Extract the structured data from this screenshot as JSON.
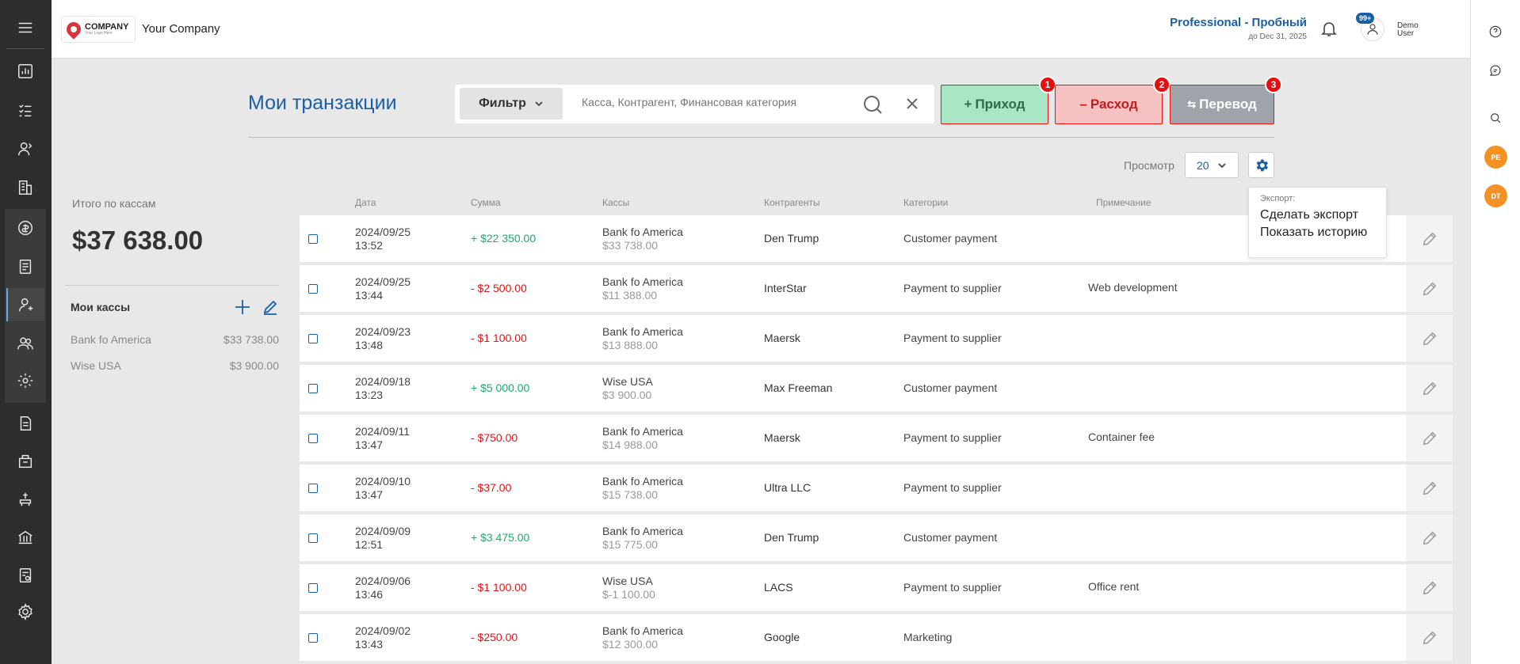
{
  "header": {
    "logo_text": "COMPANY",
    "logo_tagline": "Your Logo Here",
    "company_name": "Your Company",
    "plan_title": "Professional - Пробный",
    "plan_expiry": "до Dec 31, 2025",
    "notifications_badge": "99+",
    "user_name": "Demo User"
  },
  "page": {
    "title": "Мои транзакции",
    "filter_label": "Фильтр",
    "search_placeholder": "Касса, Контрагент, Финансовая категория"
  },
  "actions": {
    "income_label": "Приход",
    "income_badge": "1",
    "expense_label": "Расход",
    "expense_badge": "2",
    "transfer_label": "Перевод",
    "transfer_badge": "3"
  },
  "view": {
    "label": "Просмотр",
    "page_size": "20"
  },
  "export_menu": {
    "title": "Экспорт:",
    "items": [
      "Сделать экспорт",
      "Показать историю"
    ]
  },
  "summary": {
    "total_label": "Итого по кассам",
    "total_value": "$37 638.00",
    "cash_title": "Мои кассы",
    "cashboxes": [
      {
        "name": "Bank fo America",
        "amount": "$33 738.00"
      },
      {
        "name": "Wise USA",
        "amount": "$3 900.00"
      }
    ]
  },
  "table": {
    "columns": [
      "Дата",
      "Сумма",
      "Кассы",
      "Контрагенты",
      "Категории",
      "Примечание"
    ],
    "rows": [
      {
        "date": "2024/09/25",
        "time": "13:52",
        "amount": "+ $22 350.00",
        "type": "pos",
        "account": "Bank fo America",
        "balance": "$33 738.00",
        "counterparty": "Den Trump",
        "category": "Customer payment",
        "note": ""
      },
      {
        "date": "2024/09/25",
        "time": "13:44",
        "amount": "- $2 500.00",
        "type": "neg",
        "account": "Bank fo America",
        "balance": "$11 388.00",
        "counterparty": "InterStar",
        "category": "Payment to supplier",
        "note": "Web development"
      },
      {
        "date": "2024/09/23",
        "time": "13:48",
        "amount": "- $1 100.00",
        "type": "neg",
        "account": "Bank fo America",
        "balance": "$13 888.00",
        "counterparty": "Maersk",
        "category": "Payment to supplier",
        "note": ""
      },
      {
        "date": "2024/09/18",
        "time": "13:23",
        "amount": "+ $5 000.00",
        "type": "pos",
        "account": "Wise USA",
        "balance": "$3 900.00",
        "counterparty": "Max Freeman",
        "category": "Customer payment",
        "note": ""
      },
      {
        "date": "2024/09/11",
        "time": "13:47",
        "amount": "- $750.00",
        "type": "neg",
        "account": "Bank fo America",
        "balance": "$14 988.00",
        "counterparty": "Maersk",
        "category": "Payment to supplier",
        "note": "Container fee"
      },
      {
        "date": "2024/09/10",
        "time": "13:47",
        "amount": "- $37.00",
        "type": "neg",
        "account": "Bank fo America",
        "balance": "$15 738.00",
        "counterparty": "Ultra LLC",
        "category": "Payment to supplier",
        "note": ""
      },
      {
        "date": "2024/09/09",
        "time": "12:51",
        "amount": "+ $3 475.00",
        "type": "pos",
        "account": "Bank fo America",
        "balance": "$15 775.00",
        "counterparty": "Den Trump",
        "category": "Customer payment",
        "note": ""
      },
      {
        "date": "2024/09/06",
        "time": "13:46",
        "amount": "- $1 100.00",
        "type": "neg",
        "account": "Wise USA",
        "balance": "$-1 100.00",
        "counterparty": "LACS",
        "category": "Payment to supplier",
        "note": "Office rent"
      },
      {
        "date": "2024/09/02",
        "time": "13:43",
        "amount": "- $250.00",
        "type": "neg",
        "account": "Bank fo America",
        "balance": "$12 300.00",
        "counterparty": "Google",
        "category": "Marketing",
        "note": ""
      }
    ]
  },
  "right_sidebar": {
    "avatars": [
      "PE",
      "DT"
    ]
  },
  "colors": {
    "brand_blue": "#1a5fa6",
    "positive": "#17ad68",
    "negative": "#e01515",
    "sidebar_dark": "#2d2d2d",
    "avatar_orange": "#f39222"
  }
}
